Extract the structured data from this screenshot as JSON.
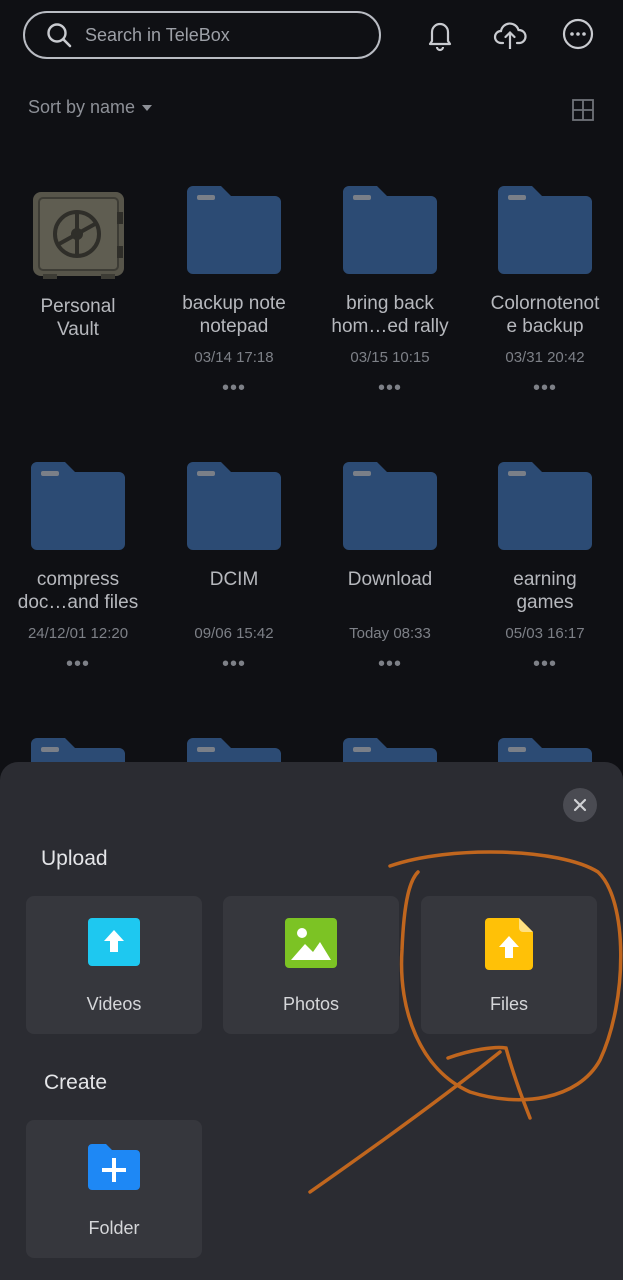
{
  "search": {
    "placeholder": "Search in TeleBox"
  },
  "toolbar": {
    "sort_label": "Sort by name"
  },
  "items": [
    {
      "name": "Personal\nVault",
      "date": "",
      "type": "vault"
    },
    {
      "name": "backup note\nnotepad",
      "date": "03/14 17:18",
      "type": "folder"
    },
    {
      "name": "bring back\nhom…ed rally",
      "date": "03/15 10:15",
      "type": "folder"
    },
    {
      "name": "Colornotenot\ne backup",
      "date": "03/31 20:42",
      "type": "folder"
    },
    {
      "name": "compress\ndoc…and files",
      "date": "24/12/01 12:20",
      "type": "folder"
    },
    {
      "name": "DCIM",
      "date": "09/06 15:42",
      "type": "folder"
    },
    {
      "name": "Download",
      "date": "Today 08:33",
      "type": "folder"
    },
    {
      "name": "earning\ngames",
      "date": "05/03 16:17",
      "type": "folder"
    }
  ],
  "more_glyph": "•••",
  "sheet": {
    "upload_title": "Upload",
    "create_title": "Create",
    "upload_options": [
      {
        "label": "Videos",
        "icon": "video-upload-icon",
        "color": "#1ec8f0"
      },
      {
        "label": "Photos",
        "icon": "photo-upload-icon",
        "color": "#7cc324"
      },
      {
        "label": "Files",
        "icon": "file-upload-icon",
        "color": "#ffc107"
      }
    ],
    "create_options": [
      {
        "label": "Folder",
        "icon": "new-folder-icon",
        "color": "#1e88f5"
      }
    ]
  },
  "colors": {
    "folder": "#2c4b74",
    "annotation": "#c0661e"
  }
}
